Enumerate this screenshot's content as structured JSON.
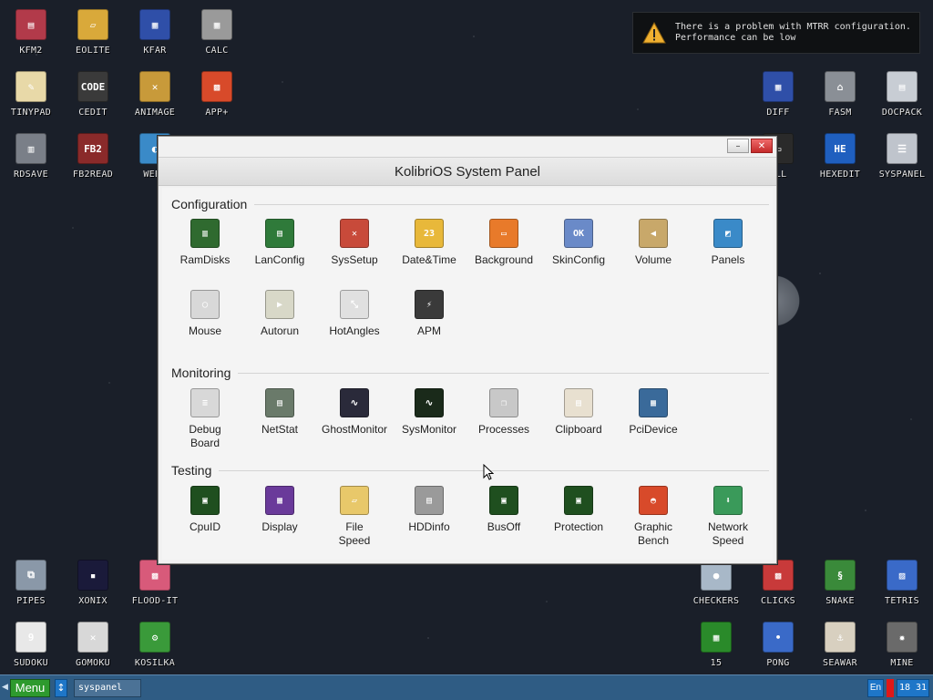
{
  "notification": {
    "line1": "There is a problem with MTRR configuration.",
    "line2": "Performance can be low"
  },
  "desktop_left": [
    {
      "label": "KFM2",
      "color": "#b23a4a",
      "glyph": "▤"
    },
    {
      "label": "EOLITE",
      "color": "#d9a93a",
      "glyph": "▱"
    },
    {
      "label": "KFAR",
      "color": "#2f4fa8",
      "glyph": "▦"
    },
    {
      "label": "CALC",
      "color": "#9a9a9a",
      "glyph": "▦"
    },
    {
      "label": "TINYPAD",
      "color": "#e8d9a8",
      "glyph": "✎"
    },
    {
      "label": "CEDIT",
      "color": "#3a3a3a",
      "glyph": "CODE"
    },
    {
      "label": "ANIMAGE",
      "color": "#c89a3a",
      "glyph": "✕"
    },
    {
      "label": "APP+",
      "color": "#d84a2a",
      "glyph": "▩"
    },
    {
      "label": "RDSAVE",
      "color": "#7a7f88",
      "glyph": "▥"
    },
    {
      "label": "FB2READ",
      "color": "#8a2a2a",
      "glyph": "FB2"
    },
    {
      "label": "WEBV",
      "color": "#3a8ac8",
      "glyph": "◐"
    }
  ],
  "desktop_right": [
    {
      "label": "DIFF",
      "color": "#2f4fa8",
      "glyph": "▦"
    },
    {
      "label": "FASM",
      "color": "#8a8f96",
      "glyph": "⌂"
    },
    {
      "label": "DOCPACK",
      "color": "#c8cdd4",
      "glyph": "▤"
    },
    {
      "label": "ELL",
      "color": "#2a2a2a",
      "glyph": "▭"
    },
    {
      "label": "HEXEDIT",
      "color": "#1f5fbf",
      "glyph": "HE"
    },
    {
      "label": "SYSPANEL",
      "color": "#bfc4cc",
      "glyph": "☰"
    }
  ],
  "desktop_bottom_left": [
    {
      "label": "PIPES",
      "color": "#8a98a8",
      "glyph": "⧉"
    },
    {
      "label": "XONIX",
      "color": "#1a1a3a",
      "glyph": "▪"
    },
    {
      "label": "FLOOD-IT",
      "color": "#d85a7a",
      "glyph": "▩"
    },
    {
      "label": "SUDOKU",
      "color": "#e8e8e8",
      "glyph": "9"
    },
    {
      "label": "GOMOKU",
      "color": "#d8d8d8",
      "glyph": "✕"
    },
    {
      "label": "KOSILKA",
      "color": "#3a9a3a",
      "glyph": "⚙"
    }
  ],
  "desktop_bottom_right": [
    {
      "label": "CHECKERS",
      "color": "#a8b8c8",
      "glyph": "●"
    },
    {
      "label": "CLICKS",
      "color": "#c83a3a",
      "glyph": "▩"
    },
    {
      "label": "SNAKE",
      "color": "#3a8a3a",
      "glyph": "§"
    },
    {
      "label": "TETRIS",
      "color": "#3a6ac8",
      "glyph": "▨"
    },
    {
      "label": "15",
      "color": "#2a8a2a",
      "glyph": "▦"
    },
    {
      "label": "PONG",
      "color": "#3a6ac8",
      "glyph": "•"
    },
    {
      "label": "SEAWAR",
      "color": "#d8d0c0",
      "glyph": "⚓"
    },
    {
      "label": "MINE",
      "color": "#6a6a6a",
      "glyph": "✹"
    }
  ],
  "window": {
    "title": "KolibriOS System Panel",
    "minimize": "–",
    "close": "✕"
  },
  "sections": {
    "configuration": "Configuration",
    "monitoring": "Monitoring",
    "testing": "Testing"
  },
  "configuration_apps": [
    {
      "label": "RamDisks",
      "color": "#2f6a2f",
      "glyph": "▥"
    },
    {
      "label": "LanConfig",
      "color": "#2f7a3a",
      "glyph": "▤"
    },
    {
      "label": "SysSetup",
      "color": "#c84a3a",
      "glyph": "✕"
    },
    {
      "label": "Date&Time",
      "color": "#e8b83a",
      "glyph": "23"
    },
    {
      "label": "Background",
      "color": "#e87a2a",
      "glyph": "▭"
    },
    {
      "label": "SkinConfig",
      "color": "#6a8ac8",
      "glyph": "OK"
    },
    {
      "label": "Volume",
      "color": "#c8a86a",
      "glyph": "◀"
    },
    {
      "label": "Panels",
      "color": "#3a8ac8",
      "glyph": "◩"
    },
    {
      "label": "Mouse",
      "color": "#d8d8d8",
      "glyph": "◯"
    },
    {
      "label": "Autorun",
      "color": "#d8d8c8",
      "glyph": "▶"
    },
    {
      "label": "HotAngles",
      "color": "#e0e0e0",
      "glyph": "⤡"
    },
    {
      "label": "APM",
      "color": "#3a3a3a",
      "glyph": "⚡"
    }
  ],
  "monitoring_apps": [
    {
      "label": "Debug\nBoard",
      "color": "#d8d8d8",
      "glyph": "≡"
    },
    {
      "label": "NetStat",
      "color": "#6a7a6a",
      "glyph": "▤"
    },
    {
      "label": "GhostMonitor",
      "color": "#2a2a3a",
      "glyph": "∿"
    },
    {
      "label": "SysMonitor",
      "color": "#1a2a1a",
      "glyph": "∿"
    },
    {
      "label": "Processes",
      "color": "#c8c8c8",
      "glyph": "❐"
    },
    {
      "label": "Clipboard",
      "color": "#e8e0d0",
      "glyph": "▤"
    },
    {
      "label": "PciDevice",
      "color": "#3a6a9a",
      "glyph": "▦"
    }
  ],
  "testing_apps": [
    {
      "label": "CpuID",
      "color": "#1f4f1f",
      "glyph": "▣"
    },
    {
      "label": "Display",
      "color": "#6a3a9a",
      "glyph": "▦"
    },
    {
      "label": "File\nSpeed",
      "color": "#e8c86a",
      "glyph": "▱"
    },
    {
      "label": "HDDinfo",
      "color": "#9a9a9a",
      "glyph": "▤"
    },
    {
      "label": "BusOff",
      "color": "#1f4f1f",
      "glyph": "▣"
    },
    {
      "label": "Protection",
      "color": "#1f4f1f",
      "glyph": "▣"
    },
    {
      "label": "Graphic\nBench",
      "color": "#d84a2a",
      "glyph": "◓"
    },
    {
      "label": "Network\nSpeed",
      "color": "#3a9a5a",
      "glyph": "⬇"
    }
  ],
  "taskbar": {
    "menu": "Menu",
    "switch": "↕",
    "task": "syspanel",
    "lang": "En",
    "clock": "18 31"
  }
}
